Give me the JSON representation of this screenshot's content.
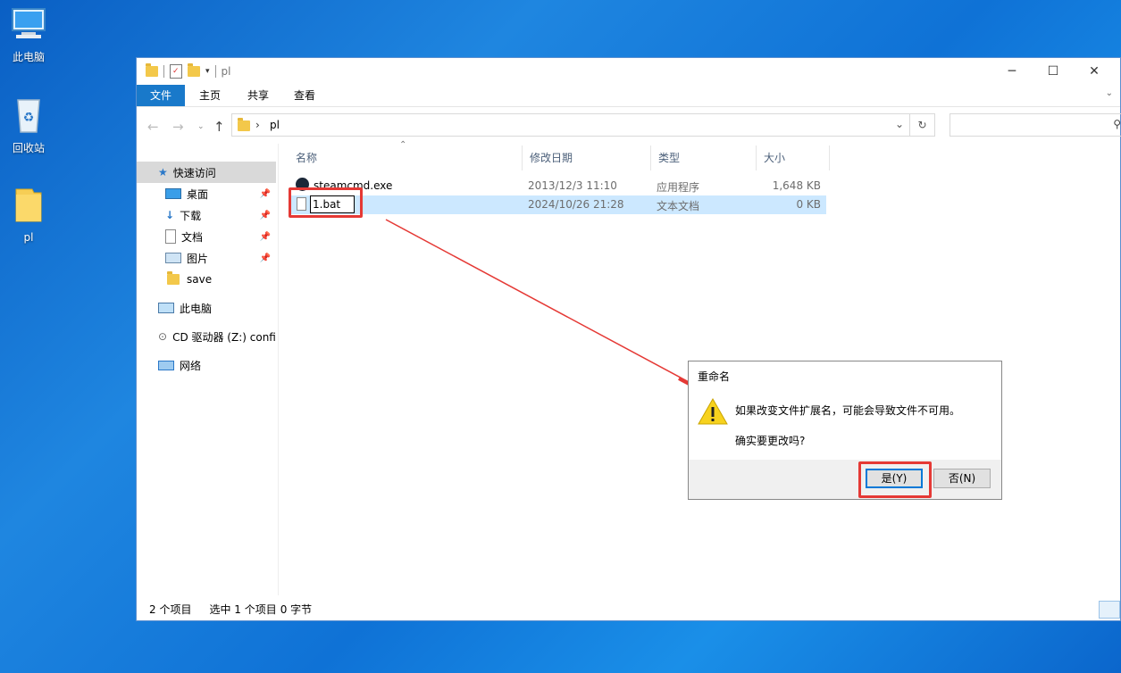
{
  "desktop": {
    "icons": [
      {
        "label": "此电脑"
      },
      {
        "label": "回收站"
      },
      {
        "label": "pl"
      }
    ]
  },
  "window": {
    "title": "pl",
    "controls": {
      "minimize": "─",
      "maximize": "☐",
      "close": "✕"
    },
    "ribbon_tabs": [
      "文件",
      "主页",
      "共享",
      "查看"
    ],
    "address_path": "pl",
    "sidebar": {
      "quick_access": "快速访问",
      "items": [
        {
          "label": "桌面",
          "pinned": true
        },
        {
          "label": "下载",
          "pinned": true
        },
        {
          "label": "文档",
          "pinned": true
        },
        {
          "label": "图片",
          "pinned": true
        },
        {
          "label": "save",
          "pinned": false
        }
      ],
      "this_pc": "此电脑",
      "cd_drive": "CD 驱动器 (Z:) confi",
      "network": "网络"
    },
    "columns": [
      "名称",
      "修改日期",
      "类型",
      "大小"
    ],
    "files": [
      {
        "name": "steamcmd.exe",
        "date": "2013/12/3 11:10",
        "type": "应用程序",
        "size": "1,648 KB",
        "selected": false
      },
      {
        "name": "1.bat",
        "date": "2024/10/26 21:28",
        "type": "文本文档",
        "size": "0 KB",
        "selected": true
      }
    ],
    "status": {
      "count": "2 个项目",
      "selected": "选中 1 个项目",
      "bytes": "0 字节"
    }
  },
  "dialog": {
    "title": "重命名",
    "message": "如果改变文件扩展名，可能会导致文件不可用。",
    "question": "确实要更改吗?",
    "yes_label": "是(Y)",
    "no_label": "否(N)"
  },
  "annotation_color": "#e53935"
}
